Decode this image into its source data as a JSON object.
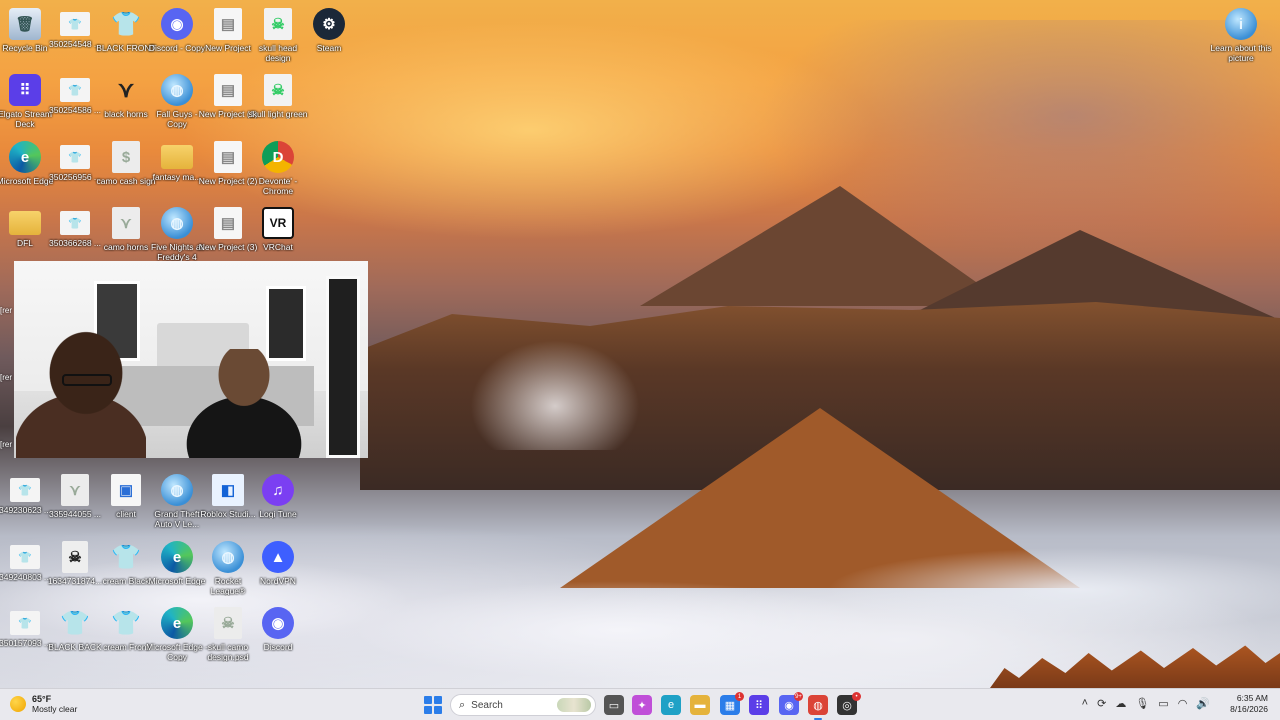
{
  "desktop_icons": [
    {
      "label": "Recycle Bin",
      "icon": "recycle-bin-icon",
      "glyph": "🗑",
      "style": "g-bin",
      "name": "desktop-icon-recycle-bin"
    },
    {
      "label": "350254548 ...",
      "icon": "image-file-icon",
      "glyph": "👕",
      "style": "g-thumb",
      "name": "desktop-icon-350254548"
    },
    {
      "label": "BLACK FRONT",
      "icon": "tshirt-icon",
      "glyph": "👕",
      "style": "g-black",
      "name": "desktop-icon-black-front"
    },
    {
      "label": "Discord - Copy",
      "icon": "discord-icon",
      "glyph": "◉",
      "style": "g-discord",
      "name": "desktop-icon-discord-copy"
    },
    {
      "label": "New Project",
      "icon": "document-icon",
      "glyph": "▤",
      "style": "g-page",
      "name": "desktop-icon-new-project"
    },
    {
      "label": "skull head design",
      "icon": "skull-icon",
      "glyph": "☠",
      "style": "g-skull",
      "name": "desktop-icon-skull-head-design"
    },
    {
      "label": "Steam",
      "icon": "steam-icon",
      "glyph": "⚙",
      "style": "g-steam",
      "name": "desktop-icon-steam"
    },
    {
      "label": "Elgato Stream Deck",
      "icon": "stream-deck-icon",
      "glyph": "⠿",
      "style": "g-elgato",
      "name": "desktop-icon-elgato"
    },
    {
      "label": "350254586 ...",
      "icon": "image-file-icon",
      "glyph": "👕",
      "style": "g-thumb",
      "name": "desktop-icon-350254586"
    },
    {
      "label": "black horns",
      "icon": "horns-icon",
      "glyph": "⋎",
      "style": "g-horns",
      "name": "desktop-icon-black-horns"
    },
    {
      "label": "Fall Guys - Copy",
      "icon": "globe-icon",
      "glyph": "◍",
      "style": "g-globe",
      "name": "desktop-icon-fall-guys"
    },
    {
      "label": "New Project (1)",
      "icon": "document-icon",
      "glyph": "▤",
      "style": "g-page",
      "name": "desktop-icon-new-project-1"
    },
    {
      "label": "skull light green",
      "icon": "skull-icon",
      "glyph": "☠",
      "style": "g-skull",
      "name": "desktop-icon-skull-light-green"
    },
    {
      "label": "Microsoft Edge",
      "icon": "edge-icon",
      "glyph": "e",
      "style": "g-edge",
      "name": "desktop-icon-edge-1"
    },
    {
      "label": "350256956 ...",
      "icon": "image-file-icon",
      "glyph": "👕",
      "style": "g-thumb",
      "name": "desktop-icon-350256956"
    },
    {
      "label": "camo cash sign",
      "icon": "image-file-icon",
      "glyph": "$",
      "style": "g-camo",
      "name": "desktop-icon-camo-cash-sign"
    },
    {
      "label": "fantasy ma...",
      "icon": "folder-icon",
      "glyph": "",
      "style": "g-folder",
      "name": "desktop-icon-fantasy"
    },
    {
      "label": "New Project (2)",
      "icon": "document-icon",
      "glyph": "▤",
      "style": "g-page",
      "name": "desktop-icon-new-project-2"
    },
    {
      "label": "Devonte' - Chrome",
      "icon": "chrome-icon",
      "glyph": "D",
      "style": "g-chrome",
      "name": "desktop-icon-chrome-profile"
    },
    {
      "label": "DFL",
      "icon": "folder-icon",
      "glyph": "",
      "style": "g-folder",
      "name": "desktop-icon-dfl"
    },
    {
      "label": "350366268 ...",
      "icon": "image-file-icon",
      "glyph": "👕",
      "style": "g-thumb",
      "name": "desktop-icon-350366268"
    },
    {
      "label": "camo horns",
      "icon": "image-file-icon",
      "glyph": "⋎",
      "style": "g-camo",
      "name": "desktop-icon-camo-horns"
    },
    {
      "label": "Five Nights at Freddy's 4",
      "icon": "globe-icon",
      "glyph": "◍",
      "style": "g-globe",
      "name": "desktop-icon-fnaf4"
    },
    {
      "label": "New Project (3)",
      "icon": "document-icon",
      "glyph": "▤",
      "style": "g-page",
      "name": "desktop-icon-new-project-3"
    },
    {
      "label": "VRChat",
      "icon": "vr-icon",
      "glyph": "VR",
      "style": "g-vr",
      "name": "desktop-icon-vrchat"
    },
    {
      "label": "349230623 ...",
      "icon": "image-file-icon",
      "glyph": "👕",
      "style": "g-thumb",
      "name": "desktop-icon-349230623"
    },
    {
      "label": "335944055 ...",
      "icon": "image-file-icon",
      "glyph": "⋎",
      "style": "g-camo",
      "name": "desktop-icon-335944055"
    },
    {
      "label": "client",
      "icon": "app-file-icon",
      "glyph": "▣",
      "style": "g-client",
      "name": "desktop-icon-client"
    },
    {
      "label": "Grand Theft Auto V Le...",
      "icon": "globe-icon",
      "glyph": "◍",
      "style": "g-globe",
      "name": "desktop-icon-gta5"
    },
    {
      "label": "Roblox Studi...",
      "icon": "roblox-icon",
      "glyph": "◧",
      "style": "g-roblox",
      "name": "desktop-icon-roblox-studio"
    },
    {
      "label": "Logi Tune",
      "icon": "logi-tune-icon",
      "glyph": "♫",
      "style": "g-tune",
      "name": "desktop-icon-logi-tune"
    },
    {
      "label": "349240803 ...",
      "icon": "image-file-icon",
      "glyph": "👕",
      "style": "g-thumb",
      "name": "desktop-icon-349240803"
    },
    {
      "label": "1634731874...",
      "icon": "skull-icon",
      "glyph": "☠",
      "style": "g-skullbig",
      "name": "desktop-icon-1634731874"
    },
    {
      "label": "cream Black",
      "icon": "tshirt-icon",
      "glyph": "👕",
      "style": "g-tee",
      "name": "desktop-icon-cream-black"
    },
    {
      "label": "Microsoft Edge",
      "icon": "edge-icon",
      "glyph": "e",
      "style": "g-edge",
      "name": "desktop-icon-edge-2"
    },
    {
      "label": "Rocket League®",
      "icon": "globe-icon",
      "glyph": "◍",
      "style": "g-globe",
      "name": "desktop-icon-rocket-league"
    },
    {
      "label": "NordVPN",
      "icon": "nordvpn-icon",
      "glyph": "▲",
      "style": "g-nord",
      "name": "desktop-icon-nordvpn"
    },
    {
      "label": "350157093 ...",
      "icon": "image-file-icon",
      "glyph": "👕",
      "style": "g-thumb",
      "name": "desktop-icon-350157093"
    },
    {
      "label": "BLACK BACK",
      "icon": "tshirt-icon",
      "glyph": "👕",
      "style": "g-teeb",
      "name": "desktop-icon-black-back"
    },
    {
      "label": "cream Front",
      "icon": "tshirt-icon",
      "glyph": "👕",
      "style": "g-tee",
      "name": "desktop-icon-cream-front"
    },
    {
      "label": "Microsoft Edge - Copy",
      "icon": "edge-icon",
      "glyph": "e",
      "style": "g-edge",
      "name": "desktop-icon-edge-copy"
    },
    {
      "label": "skull camo design.psd",
      "icon": "image-file-icon",
      "glyph": "☠",
      "style": "g-camo",
      "name": "desktop-icon-skull-camo-psd"
    },
    {
      "label": "Discord",
      "icon": "discord-icon",
      "glyph": "◉",
      "style": "g-discord",
      "name": "desktop-icon-discord"
    },
    {
      "label": "Learn about this picture",
      "icon": "info-icon",
      "glyph": "i",
      "style": "g-globe",
      "name": "desktop-icon-learn-about-picture"
    }
  ],
  "side_fragments": [
    "[rer",
    "[rer",
    "[rer"
  ],
  "taskbar": {
    "weather_temp": "65°F",
    "weather_desc": "Mostly clear",
    "search_placeholder": "Search",
    "pinned": [
      {
        "name": "taskbar-task-view",
        "icon": "task-view-icon",
        "glyph": "▭",
        "color": "#555555"
      },
      {
        "name": "taskbar-copilot",
        "icon": "copilot-icon",
        "glyph": "✦",
        "color": "#c04fd8"
      },
      {
        "name": "taskbar-edge",
        "icon": "edge-icon",
        "glyph": "e",
        "color": "#1fa1c6"
      },
      {
        "name": "taskbar-file-explorer",
        "icon": "folder-icon",
        "glyph": "▬",
        "color": "#e5b33c"
      },
      {
        "name": "taskbar-store",
        "icon": "store-icon",
        "glyph": "▦",
        "color": "#2b7de9",
        "badge": "1"
      },
      {
        "name": "taskbar-stream-deck",
        "icon": "stream-deck-icon",
        "glyph": "⠿",
        "color": "#5b3ee8"
      },
      {
        "name": "taskbar-discord",
        "icon": "discord-icon",
        "glyph": "◉",
        "color": "#5865f2",
        "badge": "9+"
      },
      {
        "name": "taskbar-chrome",
        "icon": "chrome-icon",
        "glyph": "◍",
        "color": "#db4437",
        "active": true
      },
      {
        "name": "taskbar-obs",
        "icon": "obs-icon",
        "glyph": "◎",
        "color": "#333333",
        "badge": "•"
      }
    ],
    "tray_icons": [
      "chevron-up-icon",
      "sync-icon",
      "onedrive-icon",
      "microphone-icon",
      "display-icon",
      "wifi-icon",
      "volume-icon"
    ],
    "time": "6:35 AM",
    "date": "8/16/2026"
  },
  "colors": {
    "accent": "#2b7de9",
    "taskbar_bg": "#e9e9ee"
  }
}
